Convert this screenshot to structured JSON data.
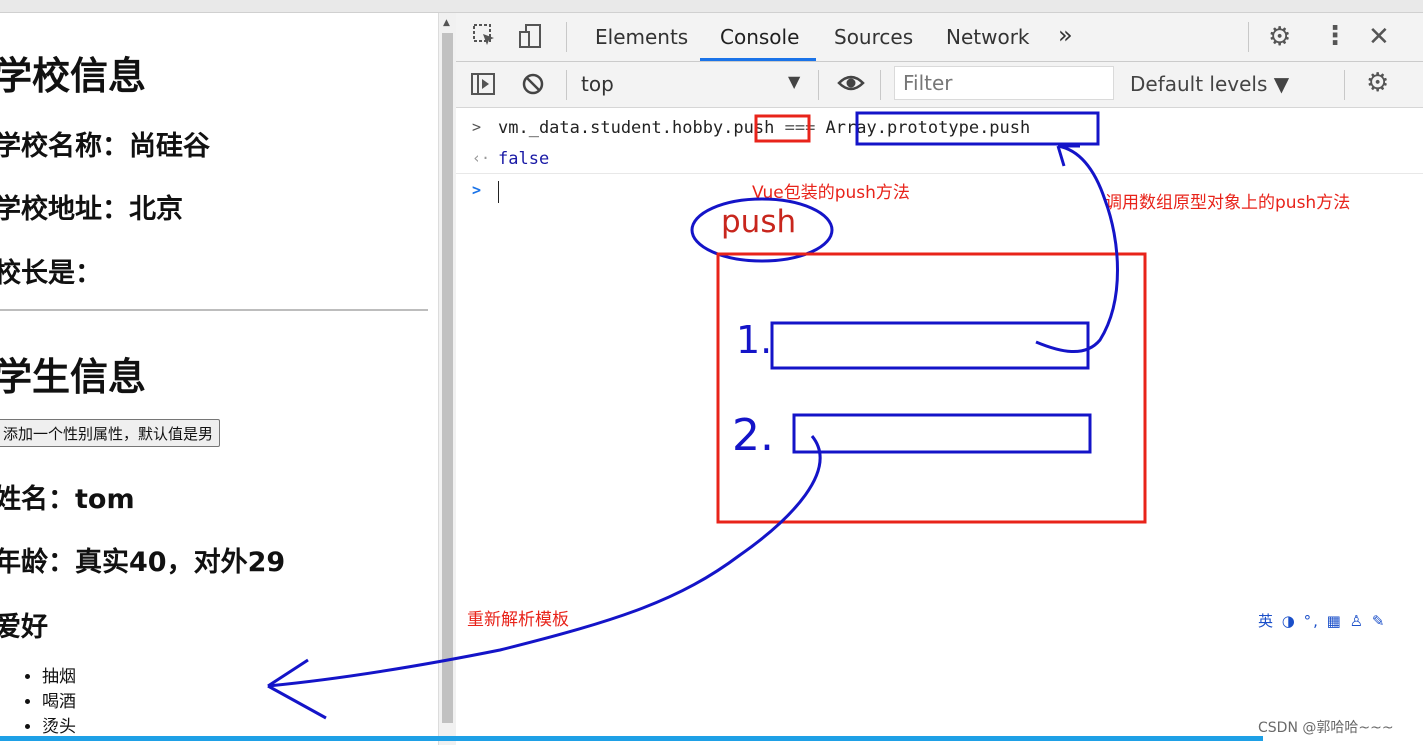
{
  "browser": {
    "address_fragment": "file:///... ",
    "address_visible": ""
  },
  "page": {
    "section_school_title": "学校信息",
    "school_name": "学校名称：尚硅谷",
    "school_address": "学校地址：北京",
    "principal": "校长是：",
    "section_student_title": "学生信息",
    "add_sex_button": "添加一个性别属性，默认值是男",
    "student_name": "姓名：tom",
    "student_age": "年龄：真实40，对外29",
    "hobby_heading": "爱好",
    "hobbies": [
      "抽烟",
      "喝酒",
      "烫头"
    ]
  },
  "devtools": {
    "tabs": [
      "Elements",
      "Console",
      "Sources",
      "Network"
    ],
    "active_tab": "Console",
    "more_tabs": "»",
    "context": "top",
    "filter_placeholder": "Filter",
    "levels": "Default levels ▼",
    "console": {
      "input_expression": "vm._data.student.hobby.push === Array.prototype.push",
      "expr_prefix": "vm._data.student.hobby.",
      "expr_push": "push",
      "expr_op": " === ",
      "expr_rhs": "Array.prototype.push",
      "result": "false"
    }
  },
  "annotations": {
    "vue_push_label": "Vue包装的push方法",
    "array_proto_label": "调用数组原型对象上的push方法",
    "push_circled": "push",
    "step1": "1.",
    "step2": "2.",
    "reparse_label": "重新解析模板",
    "red": "#e8231a",
    "blue": "#1414c8"
  },
  "ime_toolbar": "英 ◑ °, ▦ ♙ ✎",
  "watermark": "CSDN @郭哈哈~~~"
}
